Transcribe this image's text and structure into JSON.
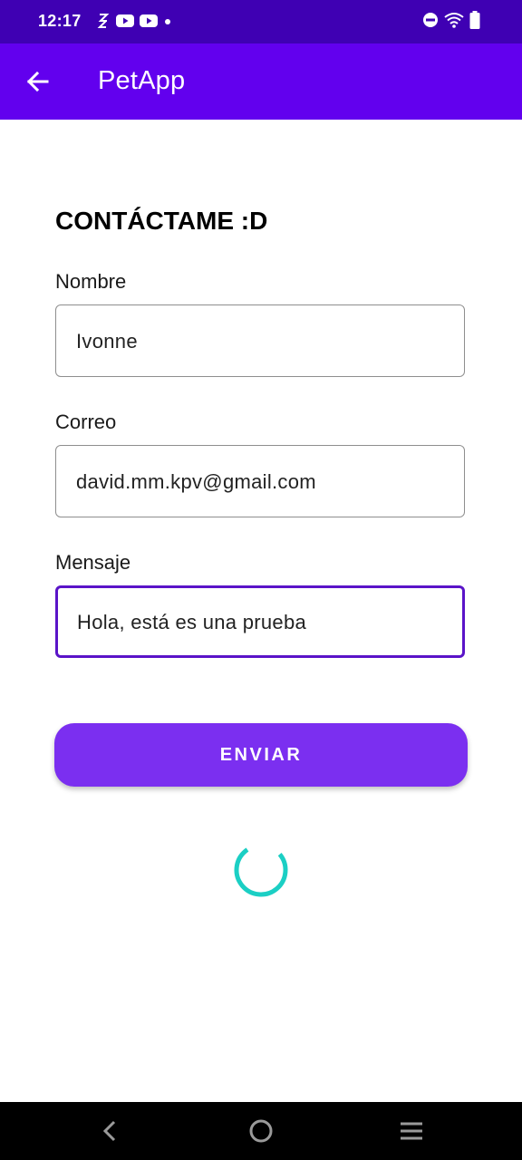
{
  "status_bar": {
    "time": "12:17",
    "left_icons": [
      "sync-icon",
      "youtube-icon",
      "youtube-icon",
      "notification-dot-icon"
    ],
    "right_icons": [
      "do-not-disturb-icon",
      "wifi-icon",
      "battery-icon"
    ]
  },
  "app_bar": {
    "title": "PetApp",
    "color": "#6200ee"
  },
  "form": {
    "heading": "CONTÁCTAME :D",
    "name": {
      "label": "Nombre",
      "value": "Ivonne"
    },
    "email": {
      "label": "Correo",
      "value": "david.mm.kpv@gmail.com"
    },
    "message": {
      "label": "Mensaje",
      "value": "Hola, está es una prueba"
    },
    "submit_label": "ENVIAR",
    "button_color": "#7b2ff0",
    "spinner_color": "#1bcfc4"
  },
  "nav_bar": {
    "buttons": [
      "back-icon",
      "home-icon",
      "menu-icon"
    ]
  }
}
